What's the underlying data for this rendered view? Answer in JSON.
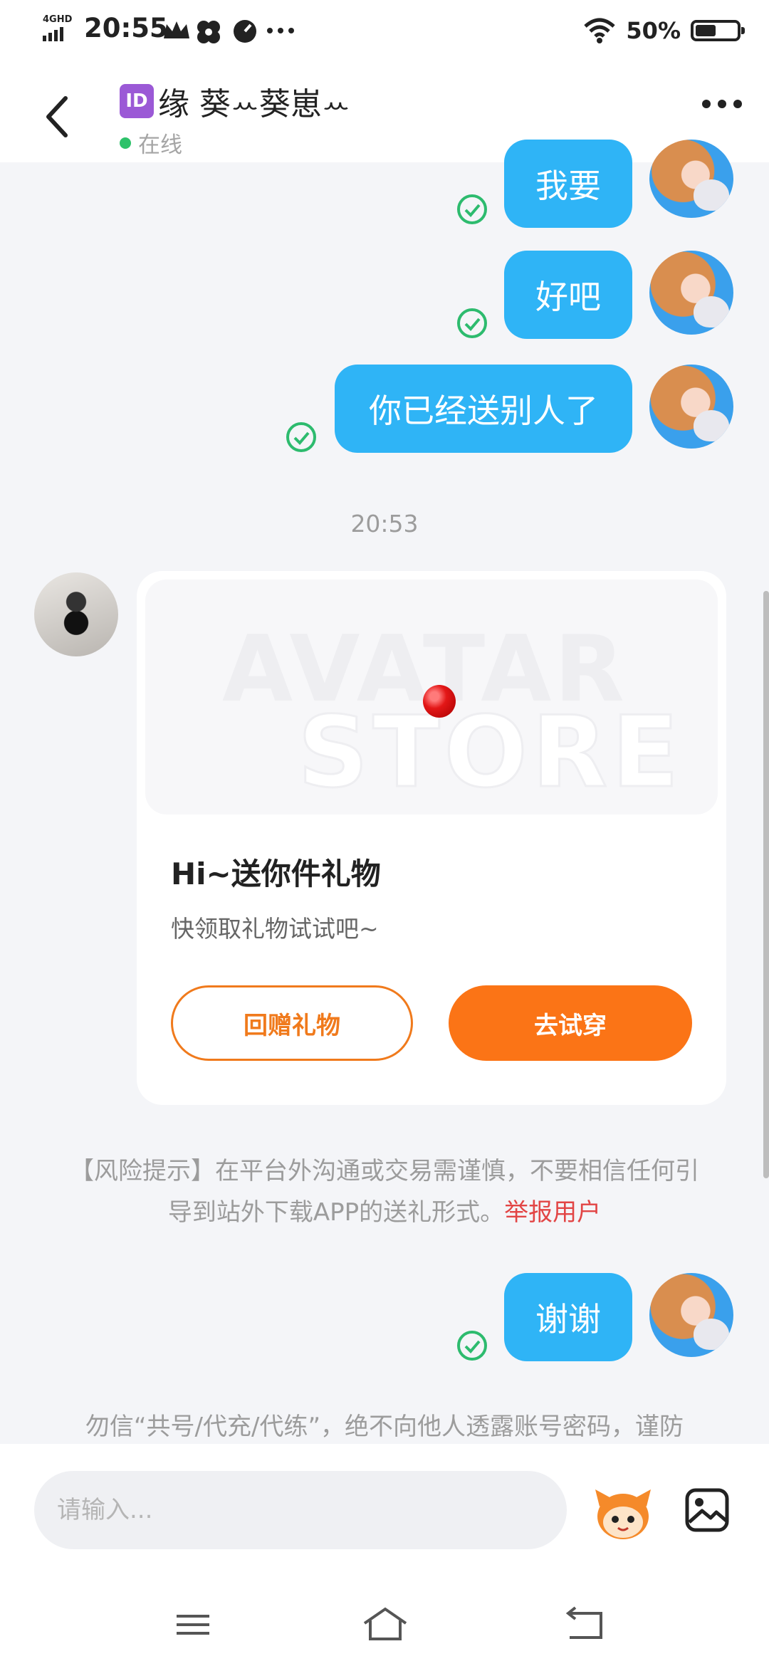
{
  "status_bar": {
    "network": "4GHD",
    "time": "20:55",
    "battery_percent": "50%",
    "battery_level": 0.5
  },
  "header": {
    "id_badge": "ID",
    "title": "缘 葵ꕀ葵崽ꕀ",
    "status": "在线"
  },
  "messages": [
    {
      "from": "me",
      "text": "我要"
    },
    {
      "from": "me",
      "text": "好吧"
    },
    {
      "from": "me",
      "text": "你已经送别人了"
    }
  ],
  "time_divider": "20:53",
  "gift_card": {
    "watermark_line1": "AVATAR",
    "watermark_line2": "STORE",
    "title": "Hi~送你件礼物",
    "subtitle": "快领取礼物试试吧~",
    "return_gift_label": "回赠礼物",
    "try_on_label": "去试穿"
  },
  "risk_notice": {
    "text": "【风险提示】在平台外沟通或交易需谨慎，不要相信任何引导到站外下载APP的送礼形式。",
    "report_link": "举报用户"
  },
  "last_message": {
    "from": "me",
    "text": "谢谢"
  },
  "bottom_notice": "勿信“共号/代充/代练”，绝不向他人透露账号密码，谨防",
  "input": {
    "placeholder": "请输入..."
  },
  "colors": {
    "bubble": "#2fb4f6",
    "accent_orange": "#fb7416",
    "online": "#2ec26a",
    "report": "#e24545"
  },
  "icons": [
    "back-arrow-icon",
    "more-dots-icon",
    "read-check-icon",
    "mascot-emoji-icon",
    "image-picker-icon",
    "menu-nav-icon",
    "home-nav-icon",
    "back-nav-icon"
  ]
}
